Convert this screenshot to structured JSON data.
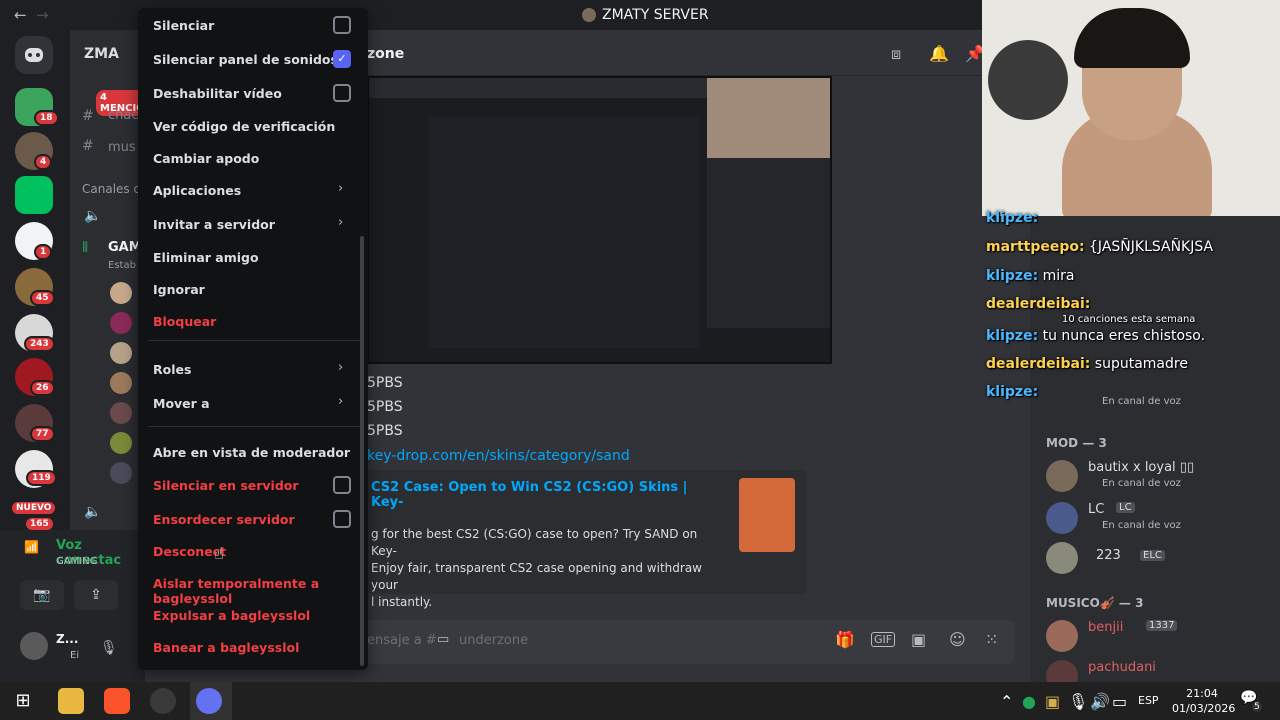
{
  "title_bar": {
    "server_name": "ZMATY SERVER",
    "back": "←",
    "forward": "→"
  },
  "server_rail": {
    "badges": [
      "18",
      "4",
      "1",
      "45",
      "243",
      "26",
      "77",
      "119",
      "165"
    ],
    "menciones": "4 MENCIO",
    "nuevo": "NUEVO"
  },
  "sidebar": {
    "server_short": "ZMA",
    "channels": [
      "chac",
      "mus"
    ],
    "category": "Canales d",
    "voice_channel": "GAM",
    "voice_sub": "Estab"
  },
  "voice_panel": {
    "status": "Voz conectac",
    "channel": "GAMING"
  },
  "user_panel": {
    "name": "Z...",
    "status": "Ei"
  },
  "chat": {
    "channel_name": "zone",
    "lines": [
      "5PBS",
      "5PBS",
      "5PBS"
    ],
    "link": "key-drop.com/en/skins/category/sand",
    "embed_title": "CS2 Case: Open to Win CS2 (CS:GO) Skins | Key-",
    "embed_desc": "g for the best CS2 (CS:GO) case to open? Try SAND on Key-\nEnjoy fair, transparent CS2 case opening and withdraw your\nl instantly.",
    "composer_placeholder": "ensaje a #",
    "composer_channel": "underzone"
  },
  "context_menu": {
    "items": [
      {
        "label": "Silenciar",
        "type": "check",
        "checked": false
      },
      {
        "label": "Silenciar panel de sonidos",
        "type": "check",
        "checked": true
      },
      {
        "label": "Deshabilitar vídeo",
        "type": "check",
        "checked": false
      },
      {
        "label": "Ver código de verificación",
        "type": "plain"
      },
      {
        "label": "Cambiar apodo",
        "type": "plain"
      },
      {
        "label": "Aplicaciones",
        "type": "submenu"
      },
      {
        "label": "Invitar a servidor",
        "type": "submenu"
      },
      {
        "label": "Eliminar amigo",
        "type": "plain"
      },
      {
        "label": "Ignorar",
        "type": "plain"
      },
      {
        "label": "Bloquear",
        "type": "danger"
      },
      {
        "label": "Roles",
        "type": "submenu"
      },
      {
        "label": "Mover a",
        "type": "submenu"
      },
      {
        "label": "Abre en vista de moderador",
        "type": "plain"
      },
      {
        "label": "Silenciar en servidor",
        "type": "danger-check"
      },
      {
        "label": "Ensordecer servidor",
        "type": "danger-check"
      },
      {
        "label": "Desconect",
        "type": "danger"
      },
      {
        "label": "Aislar temporalmente a bagleysslol",
        "type": "danger"
      },
      {
        "label": "Expulsar a bagleysslol",
        "type": "danger"
      },
      {
        "label": "Banear a bagleysslol",
        "type": "danger"
      }
    ]
  },
  "stream_chat": [
    {
      "user": "klipze:",
      "text": "",
      "color": "#4db8ff"
    },
    {
      "user": "marttpeepo:",
      "text": " {JASÑJKLSAÑKJSA",
      "color": "#ffd24d"
    },
    {
      "user": "klipze:",
      "text": " mira",
      "color": "#4db8ff"
    },
    {
      "user": "dealerdeibai:",
      "text": "",
      "color": "#ffd24d"
    },
    {
      "user": "klipze:",
      "text": " tu nunca eres chistoso.",
      "color": "#4db8ff"
    },
    {
      "user": "dealerdeibai:",
      "text": " suputamadre",
      "color": "#ffd24d"
    },
    {
      "user": "klipze:",
      "text": "",
      "color": "#4db8ff"
    }
  ],
  "stream_overlay_extra": {
    "songs": "10 canciones esta semana"
  },
  "members": {
    "top_status": "En canal de voz",
    "mod_header": "MOD — 3",
    "mods": [
      {
        "name": "bautix x loyal ▯▯",
        "status": "En canal de voz",
        "tag": ""
      },
      {
        "name": "LC",
        "status": "En canal de voz",
        "tag": "LC"
      },
      {
        "name": "223",
        "status": "",
        "tag": "ELC"
      }
    ],
    "musico_header": "MUSICO🎻 — 3",
    "musicos": [
      {
        "name": "benjii",
        "tag": "1337"
      },
      {
        "name": "pachudani",
        "tag": ""
      }
    ]
  },
  "taskbar": {
    "lang": "ESP",
    "time": "21:04",
    "date": "01/03/2026",
    "notif": "5"
  }
}
